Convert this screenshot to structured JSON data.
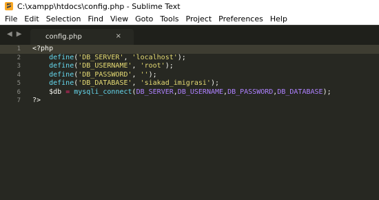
{
  "window": {
    "title": "C:\\xampp\\htdocs\\config.php - Sublime Text",
    "app_icon": "sublime-text-icon"
  },
  "menu": [
    "File",
    "Edit",
    "Selection",
    "Find",
    "View",
    "Goto",
    "Tools",
    "Project",
    "Preferences",
    "Help"
  ],
  "tabs": [
    {
      "label": "config.php",
      "close": "×",
      "active": true
    }
  ],
  "nav": {
    "back": "◀",
    "forward": "▶"
  },
  "editor": {
    "line_numbers": [
      "1",
      "2",
      "3",
      "4",
      "5",
      "6",
      "7"
    ],
    "lines": [
      [
        {
          "t": "<?php",
          "c": "tag"
        }
      ],
      [
        {
          "t": "    ",
          "c": "punc"
        },
        {
          "t": "define",
          "c": "fn"
        },
        {
          "t": "(",
          "c": "punc"
        },
        {
          "t": "'DB_SERVER'",
          "c": "str"
        },
        {
          "t": ", ",
          "c": "punc"
        },
        {
          "t": "'localhost'",
          "c": "str"
        },
        {
          "t": ");",
          "c": "punc"
        }
      ],
      [
        {
          "t": "    ",
          "c": "punc"
        },
        {
          "t": "define",
          "c": "fn"
        },
        {
          "t": "(",
          "c": "punc"
        },
        {
          "t": "'DB_USERNAME'",
          "c": "str"
        },
        {
          "t": ", ",
          "c": "punc"
        },
        {
          "t": "'root'",
          "c": "str"
        },
        {
          "t": ");",
          "c": "punc"
        }
      ],
      [
        {
          "t": "    ",
          "c": "punc"
        },
        {
          "t": "define",
          "c": "fn"
        },
        {
          "t": "(",
          "c": "punc"
        },
        {
          "t": "'DB_PASSWORD'",
          "c": "str"
        },
        {
          "t": ", ",
          "c": "punc"
        },
        {
          "t": "''",
          "c": "str"
        },
        {
          "t": ");",
          "c": "punc"
        }
      ],
      [
        {
          "t": "    ",
          "c": "punc"
        },
        {
          "t": "define",
          "c": "fn"
        },
        {
          "t": "(",
          "c": "punc"
        },
        {
          "t": "'DB_DATABASE'",
          "c": "str"
        },
        {
          "t": ", ",
          "c": "punc"
        },
        {
          "t": "'siakad_imigrasi'",
          "c": "str"
        },
        {
          "t": ");",
          "c": "punc"
        }
      ],
      [
        {
          "t": "    ",
          "c": "punc"
        },
        {
          "t": "$db",
          "c": "var"
        },
        {
          "t": " ",
          "c": "punc"
        },
        {
          "t": "=",
          "c": "op"
        },
        {
          "t": " ",
          "c": "punc"
        },
        {
          "t": "mysqli_connect",
          "c": "fn"
        },
        {
          "t": "(",
          "c": "punc"
        },
        {
          "t": "DB_SERVER",
          "c": "const"
        },
        {
          "t": ",",
          "c": "punc"
        },
        {
          "t": "DB_USERNAME",
          "c": "const"
        },
        {
          "t": ",",
          "c": "punc"
        },
        {
          "t": "DB_PASSWORD",
          "c": "const"
        },
        {
          "t": ",",
          "c": "punc"
        },
        {
          "t": "DB_DATABASE",
          "c": "const"
        },
        {
          "t": ");",
          "c": "punc"
        }
      ],
      [
        {
          "t": "?>",
          "c": "tag"
        }
      ]
    ]
  },
  "colors": {
    "background": "#272822",
    "keyword": "#f92672",
    "function": "#66d9ef",
    "string": "#e6db74",
    "constant": "#ae81ff"
  }
}
